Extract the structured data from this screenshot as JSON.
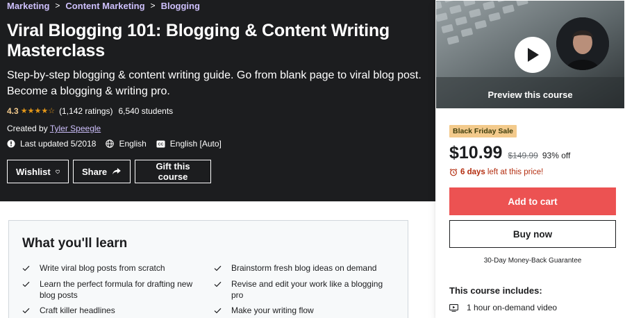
{
  "breadcrumb": [
    "Marketing",
    "Content Marketing",
    "Blogging"
  ],
  "course": {
    "title": "Viral Blogging 101: Blogging & Content Writing Masterclass",
    "subtitle": "Step-by-step blogging & content writing guide. Go from blank page to viral blog post. Become a blogging & writing pro.",
    "rating": "4.3",
    "rating_stars": 4.3,
    "ratings_count": "(1,142 ratings)",
    "students": "6,540 students",
    "created_by_label": "Created by",
    "instructor": "Tyler Speegle",
    "last_updated": "Last updated 5/2018",
    "language": "English",
    "captions": "English [Auto]"
  },
  "actions": {
    "wishlist": "Wishlist",
    "share": "Share",
    "gift": "Gift this course"
  },
  "sidebar": {
    "preview_label": "Preview this course",
    "sale_badge": "Black Friday Sale",
    "price": "$10.99",
    "original_price": "$149.99",
    "discount": "93% off",
    "timer_days": "6 days",
    "timer_text": "left at this price!",
    "add_to_cart": "Add to cart",
    "buy_now": "Buy now",
    "guarantee": "30-Day Money-Back Guarantee",
    "includes_title": "This course includes:",
    "includes": [
      "1 hour on-demand video"
    ]
  },
  "learn": {
    "title": "What you'll learn",
    "items": [
      "Write viral blog posts from scratch",
      "Brainstorm fresh blog ideas on demand",
      "Learn the perfect formula for drafting new blog posts",
      "Revise and edit your work like a blogging pro",
      "Craft killer headlines",
      "Make your writing flow"
    ]
  },
  "colors": {
    "hero_bg": "#1c1d1f",
    "breadcrumb_link": "#cec0fc",
    "rating_gold": "#f3ca8c",
    "star": "#e59819",
    "sale_badge": "#f3ca8c",
    "cart_button": "#ec5252",
    "timer": "#b32d0f"
  }
}
